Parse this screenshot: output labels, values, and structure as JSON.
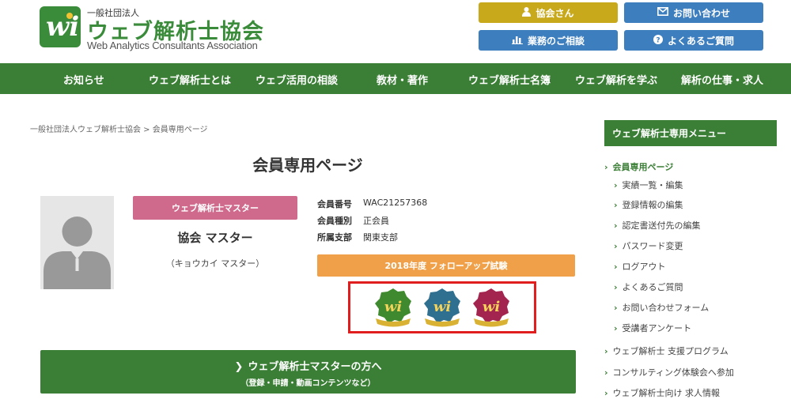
{
  "header": {
    "logo_org": "一般社団法人",
    "logo_jp": "ウェブ解析士協会",
    "logo_en": "Web Analytics Consultants Association",
    "buttons": {
      "member": "協会さん",
      "contact": "お問い合わせ",
      "consult": "業務のご相談",
      "faq": "よくあるご質問"
    },
    "colors": {
      "gold": "#c9a91c",
      "blue": "#3d7ebf"
    }
  },
  "nav": {
    "items": [
      "お知らせ",
      "ウェブ解析士とは",
      "ウェブ活用の相談",
      "教材・著作",
      "ウェブ解析士名簿",
      "ウェブ解析を学ぶ",
      "解析の仕事・求人"
    ]
  },
  "breadcrumb": "一般社団法人ウェブ解析士協会 > 会員専用ページ",
  "main": {
    "title": "会員専用ページ",
    "role_badge": "ウェブ解析士マスター",
    "name": "協会 マスター",
    "kana": "（キョウカイ マスター）",
    "info": [
      {
        "key": "会員番号",
        "value": "WAC21257368"
      },
      {
        "key": "会員種別",
        "value": "正会員"
      },
      {
        "key": "所属支部",
        "value": "関東支部"
      }
    ],
    "exam_label": "2018年度 フォローアップ試験",
    "medals": [
      {
        "name": "green-medal",
        "color": "#3f8a2e"
      },
      {
        "name": "blue-medal",
        "color": "#2f6f8f"
      },
      {
        "name": "magenta-medal",
        "color": "#a3244f"
      }
    ],
    "cta_title": "ウェブ解析士マスターの方へ",
    "cta_sub": "（登録・申請・動画コンテンツなど）"
  },
  "sidebar": {
    "heading": "ウェブ解析士専用メニュー",
    "items": [
      {
        "label": "会員専用ページ",
        "level": 0,
        "active": true
      },
      {
        "label": "実績一覧・編集",
        "level": 1
      },
      {
        "label": "登録情報の編集",
        "level": 1
      },
      {
        "label": "認定書送付先の編集",
        "level": 1
      },
      {
        "label": "パスワード変更",
        "level": 1
      },
      {
        "label": "ログアウト",
        "level": 1
      },
      {
        "label": "よくあるご質問",
        "level": 1
      },
      {
        "label": "お問い合わせフォーム",
        "level": 1
      },
      {
        "label": "受講者アンケート",
        "level": 1
      },
      {
        "label": "ウェブ解析士 支援プログラム",
        "level": 0
      },
      {
        "label": "コンサルティング体験会へ参加",
        "level": 0
      },
      {
        "label": "ウェブ解析士向け 求人情報",
        "level": 0
      }
    ]
  }
}
